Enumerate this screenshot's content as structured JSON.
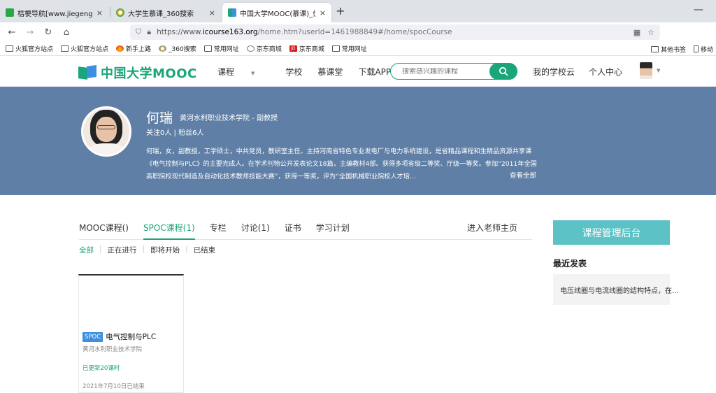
{
  "browser": {
    "tabs": [
      {
        "title": "桔梗导航[www.jiegeng.Com] - ",
        "close": "×"
      },
      {
        "title": "大学生慕课_360搜索",
        "close": "×"
      },
      {
        "title": "中国大学MOOC(慕课)_优质在线",
        "close": "×"
      }
    ],
    "new_tab": "+",
    "minimize": "—",
    "nav": {
      "back": "←",
      "forward": "→",
      "reload": "↻",
      "home": "⌂"
    },
    "url": {
      "prefix": "https://www.",
      "host": "icourse163.org",
      "path": "/home.htm?userId=1461988849#/home/spocCourse"
    },
    "bookmarks": [
      {
        "label": "火狐官方站点",
        "icon": "folder-icon"
      },
      {
        "label": "火狐官方站点",
        "icon": "folder-icon"
      },
      {
        "label": "新手上路",
        "icon": "firefox-icon"
      },
      {
        "label": "_360搜索",
        "icon": "sogou-icon"
      },
      {
        "label": "常用网址",
        "icon": "folder-icon"
      },
      {
        "label": "京东商城",
        "icon": "globe-icon"
      },
      {
        "label": "京东商城",
        "icon": "jd-icon"
      },
      {
        "label": "常用网址",
        "icon": "folder-icon"
      }
    ],
    "bookmarks_right": [
      {
        "label": "其他书签",
        "icon": "folder-icon"
      },
      {
        "label": "移动",
        "icon": "mobile-icon"
      }
    ]
  },
  "site": {
    "logo_text": "中国大学MOOC",
    "nav": [
      "课程",
      "学校",
      "慕课堂",
      "下载APP"
    ],
    "search_placeholder": "搜索感兴趣的课程",
    "right_nav": [
      "我的学校云",
      "个人中心"
    ],
    "brand_color": "#1aa57a"
  },
  "teacher": {
    "name": "何瑞",
    "school_title": "黄河水利职业技术学院  - 副教授",
    "follow": "关注0人 | 粉丝6人",
    "bio": "何瑞，女，副教授，工学硕士，中共党员，教研室主任。主持河南省特色专业发电厂与电力系统建设，是省精品课程和生精品资源共享课《电气控制与PLC》的主要完成人。在学术刊物公开发表论文18篇，主编教材4部。获得多项省级二等奖、厅级一等奖。参加“2011年全国高职院校现代制造及自动化技术教师技能大赛”，获得一等奖，评为“全国机械职业院校人才培...",
    "view_all": "查看全部",
    "banner_color": "#5f7fa6"
  },
  "tabs": {
    "items": [
      "MOOC课程()",
      "SPOC课程(1)",
      "专栏",
      "讨论(1)",
      "证书",
      "学习计划"
    ],
    "active_index": 1,
    "enter_home": "进入老师主页"
  },
  "filters": {
    "items": [
      "全部",
      "正在进行",
      "即将开始",
      "已结束"
    ],
    "separator": "|"
  },
  "course": {
    "badge": "SPOC",
    "title": "电气控制与PLC",
    "school": "黄河水利职业技术学院",
    "update": "已更新20课时",
    "date": "2021年7月10日已结束"
  },
  "sidebar": {
    "manage_button": "课程管理后台",
    "recent_title": "最近发表",
    "recent_post": "电压线圈与电流线圈的结构特点，在...",
    "button_color": "#5cc2c6"
  }
}
